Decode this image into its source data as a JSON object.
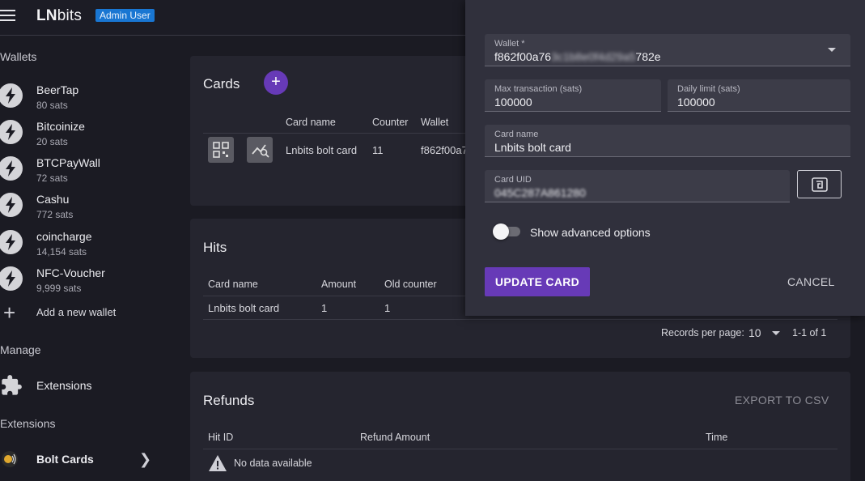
{
  "header": {
    "brand_bold": "LN",
    "brand_rest": "bits",
    "admin_badge": "Admin User"
  },
  "sidebar": {
    "wallets_title": "Wallets",
    "wallets": [
      {
        "name": "BeerTap",
        "balance": "80 sats"
      },
      {
        "name": "Bitcoinize",
        "balance": "20 sats"
      },
      {
        "name": "BTCPayWall",
        "balance": "72 sats"
      },
      {
        "name": "Cashu",
        "balance": "772 sats"
      },
      {
        "name": "coincharge",
        "balance": "14,154 sats"
      },
      {
        "name": "NFC-Voucher",
        "balance": "9,999 sats"
      }
    ],
    "add_wallet": "Add a new wallet",
    "manage_title": "Manage",
    "extensions_item": "Extensions",
    "extensions_title": "Extensions",
    "bolt_cards_item": "Bolt Cards"
  },
  "cards_panel": {
    "title": "Cards",
    "columns": [
      "Card name",
      "Counter",
      "Wallet"
    ],
    "row": {
      "card_name": "Lnbits bolt card",
      "counter": "11",
      "wallet": "f862f00a7"
    }
  },
  "hits_panel": {
    "title": "Hits",
    "columns": [
      "Card name",
      "Amount",
      "Old counter"
    ],
    "row": {
      "card_name": "Lnbits bolt card",
      "amount": "1",
      "old_counter": "1"
    },
    "records_label": "Records per page:",
    "records_value": "10",
    "range": "1-1 of 1"
  },
  "refunds_panel": {
    "title": "Refunds",
    "export": "EXPORT TO CSV",
    "columns": [
      "Hit ID",
      "Refund Amount",
      "Time"
    ],
    "empty": "No data available"
  },
  "dialog": {
    "wallet_label": "Wallet *",
    "wallet_prefix": "f862f00a76",
    "wallet_blurred": "3c1b8e0f4d29a5",
    "wallet_suffix": "782e",
    "max_tx_label": "Max transaction (sats)",
    "max_tx_value": "100000",
    "daily_label": "Daily limit (sats)",
    "daily_value": "100000",
    "card_name_label": "Card name",
    "card_name_value": "Lnbits bolt card",
    "uid_label": "Card UID",
    "uid_value": "045C287A861280",
    "advanced": "Show advanced options",
    "update": "UPDATE CARD",
    "cancel": "CANCEL"
  }
}
